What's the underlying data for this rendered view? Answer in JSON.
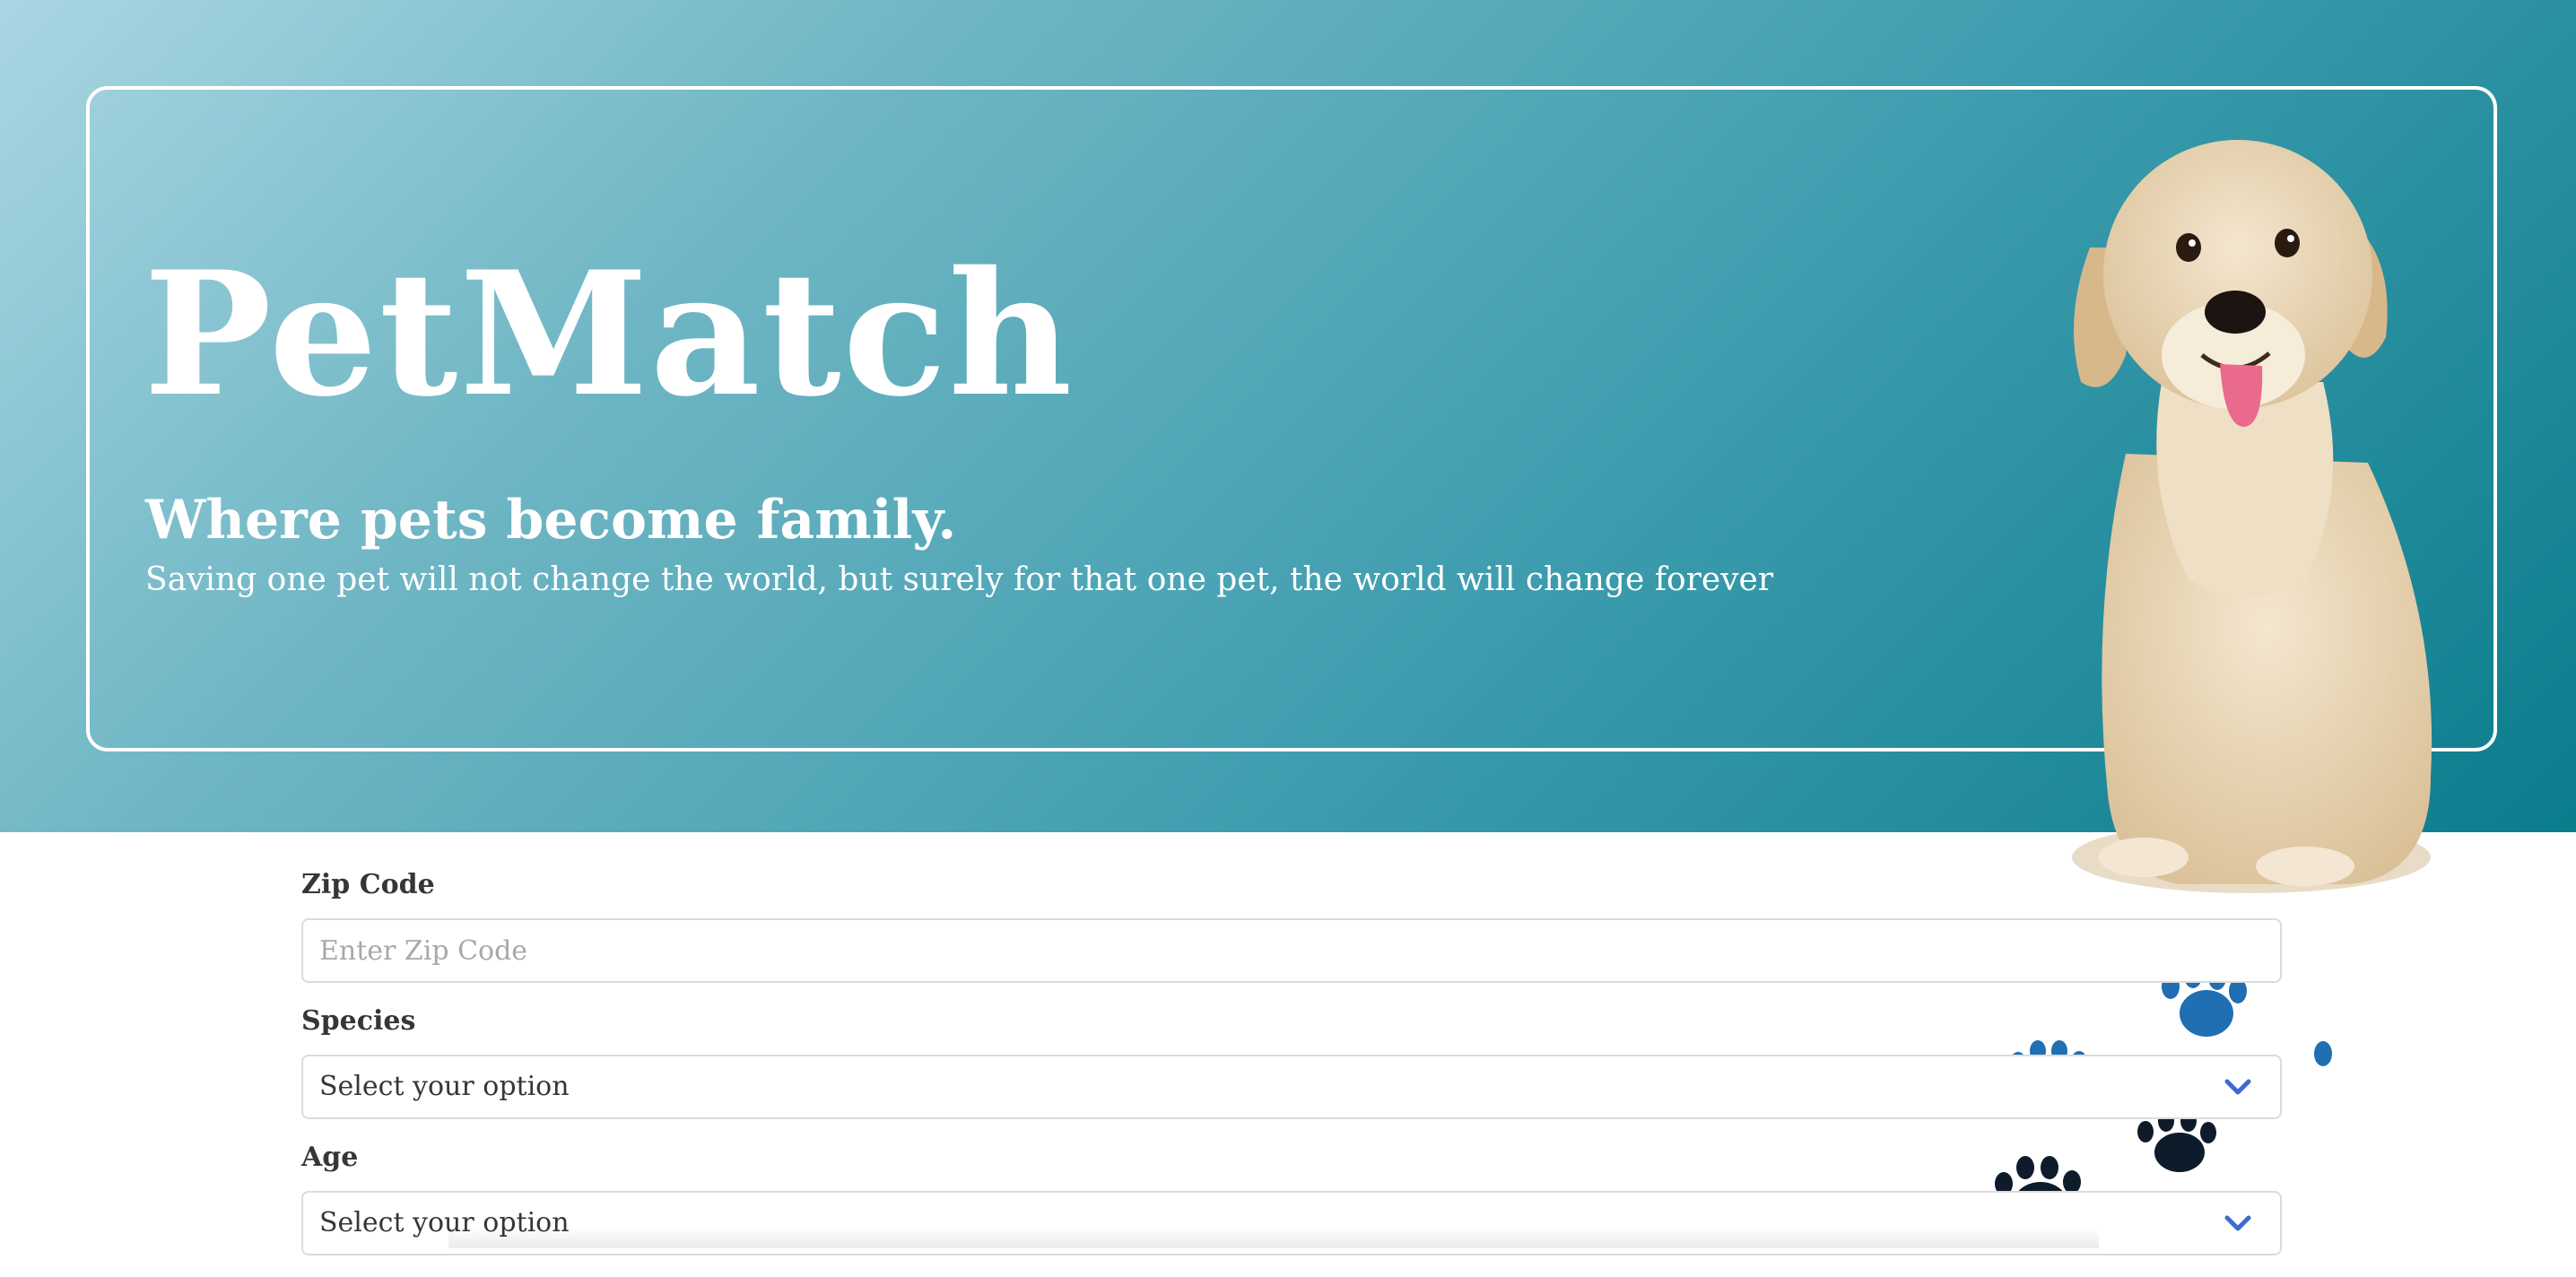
{
  "hero": {
    "brand": "PetMatch",
    "tagline": "Where pets become family.",
    "quote": "Saving one pet will not change the world, but surely for that one pet, the world will change forever"
  },
  "form": {
    "zip": {
      "label": "Zip Code",
      "placeholder": "Enter Zip Code"
    },
    "species": {
      "label": "Species",
      "selected": "Select your option"
    },
    "age": {
      "label": "Age",
      "selected": "Select your option"
    }
  },
  "icons": {
    "select_chevron": "chevron-down-icon",
    "paw": "paw-print-icon"
  },
  "colors": {
    "hero_gradient_start": "#a9d6e2",
    "hero_gradient_end": "#0a7d8c",
    "chevron": "#3e6ad3",
    "paw_blue": "#1f6fb2",
    "paw_dark": "#0d1b2a"
  }
}
